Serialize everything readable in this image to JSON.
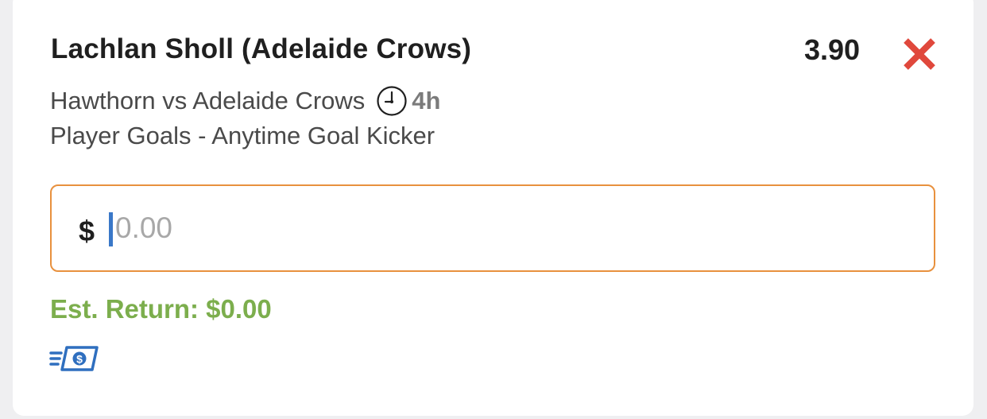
{
  "bet": {
    "selection": "Lachlan Sholl (Adelaide Crows)",
    "odds": "3.90",
    "event": "Hawthorn vs Adelaide Crows",
    "time_to_start": "4h",
    "market": "Player Goals - Anytime Goal Kicker"
  },
  "stake": {
    "currency_symbol": "$",
    "value": "",
    "placeholder": "0.00"
  },
  "est_return": "Est. Return: $0.00",
  "icons": {
    "remove": "close-x-icon",
    "clock": "clock-icon",
    "cash": "fast-cash-icon"
  },
  "colors": {
    "remove": "#e0483c",
    "input_border": "#e8913e",
    "caret": "#3a78c8",
    "return_text": "#7cae4d",
    "cash_icon": "#2f6fbf"
  }
}
